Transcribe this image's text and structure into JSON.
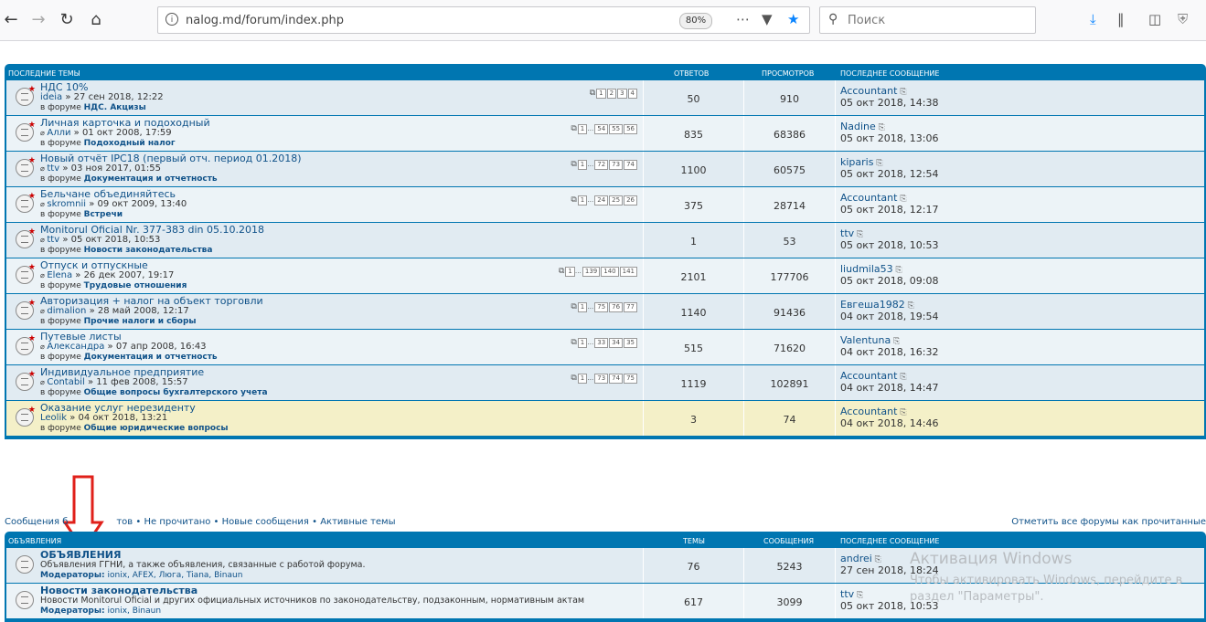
{
  "browser": {
    "url": "nalog.md/forum/index.php",
    "zoom": "80%",
    "search_placeholder": "Поиск"
  },
  "recent": {
    "header": {
      "topics": "ПОСЛЕДНИЕ ТЕМЫ",
      "replies": "ОТВЕТОВ",
      "views": "ПРОСМОТРОВ",
      "last": "ПОСЛЕДНЕЕ СООБЩЕНИЕ"
    },
    "rows": [
      {
        "title": "НДС 10%",
        "author": "ideia",
        "date": "» 27 сен 2018, 12:22",
        "forum_prefix": "в форуме",
        "forum": "НДС. Акцизы",
        "pages": [
          "1",
          "2",
          "3",
          "4"
        ],
        "replies": "50",
        "views": "910",
        "last_user": "Accountant",
        "last_date": "05 окт 2018, 14:38"
      },
      {
        "title": "Личная карточка и подоходный",
        "author": "Алли",
        "date": "» 01 окт 2008, 17:59",
        "forum_prefix": "в форуме",
        "forum": "Подоходный налог",
        "pages": [
          "1",
          "…",
          "54",
          "55",
          "56"
        ],
        "replies": "835",
        "views": "68386",
        "last_user": "Nadine",
        "last_date": "05 окт 2018, 13:06"
      },
      {
        "title": "Новый отчёт IPC18 (первый отч. период 01.2018)",
        "author": "ttv",
        "date": "» 03 ноя 2017, 01:55",
        "forum_prefix": "в форуме",
        "forum": "Документация и отчетность",
        "pages": [
          "1",
          "…",
          "72",
          "73",
          "74"
        ],
        "replies": "1100",
        "views": "60575",
        "last_user": "kiparis",
        "last_date": "05 окт 2018, 12:54"
      },
      {
        "title": "Бельчане объединяйтесь",
        "author": "skromnii",
        "date": "» 09 окт 2009, 13:40",
        "forum_prefix": "в форуме",
        "forum": "Встречи",
        "pages": [
          "1",
          "…",
          "24",
          "25",
          "26"
        ],
        "replies": "375",
        "views": "28714",
        "last_user": "Accountant",
        "last_date": "05 окт 2018, 12:17"
      },
      {
        "title": "Monitorul Oficial Nr. 377-383 din 05.10.2018",
        "author": "ttv",
        "date": "» 05 окт 2018, 10:53",
        "forum_prefix": "в форуме",
        "forum": "Новости законодательства",
        "pages": [],
        "replies": "1",
        "views": "53",
        "last_user": "ttv",
        "last_date": "05 окт 2018, 10:53"
      },
      {
        "title": "Отпуск и отпускные",
        "author": "Elena",
        "date": "» 26 дек 2007, 19:17",
        "forum_prefix": "в форуме",
        "forum": "Трудовые отношения",
        "pages": [
          "1",
          "…",
          "139",
          "140",
          "141"
        ],
        "replies": "2101",
        "views": "177706",
        "last_user": "liudmila53",
        "last_date": "05 окт 2018, 09:08"
      },
      {
        "title": "Авторизация + налог на объект торговли",
        "author": "dimalion",
        "date": "» 28 май 2008, 12:17",
        "forum_prefix": "в форуме",
        "forum": "Прочие налоги и сборы",
        "pages": [
          "1",
          "…",
          "75",
          "76",
          "77"
        ],
        "replies": "1140",
        "views": "91436",
        "last_user": "Евгеша1982",
        "last_date": "04 окт 2018, 19:54"
      },
      {
        "title": "Путевые листы",
        "author": "Александра",
        "date": "» 07 апр 2008, 16:43",
        "forum_prefix": "в форуме",
        "forum": "Документация и отчетность",
        "pages": [
          "1",
          "…",
          "33",
          "34",
          "35"
        ],
        "replies": "515",
        "views": "71620",
        "last_user": "Valentuna",
        "last_date": "04 окт 2018, 16:32"
      },
      {
        "title": "Индивидуальное предприятие",
        "author": "Contabil",
        "date": "» 11 фев 2008, 15:57",
        "forum_prefix": "в форуме",
        "forum": "Общие вопросы бухгалтерского учета",
        "pages": [
          "1",
          "…",
          "73",
          "74",
          "75"
        ],
        "replies": "1119",
        "views": "102891",
        "last_user": "Accountant",
        "last_date": "04 окт 2018, 14:47"
      },
      {
        "title": "Оказание услуг нерезиденту",
        "author": "Leolik",
        "date": "» 04 окт 2018, 13:21",
        "forum_prefix": "в форуме",
        "forum": "Общие юридические вопросы",
        "pages": [],
        "replies": "3",
        "views": "74",
        "last_user": "Accountant",
        "last_date": "04 окт 2018, 14:46"
      }
    ]
  },
  "links": {
    "left_1": "Сообщения б",
    "left_2": "тов",
    "unread": "Не прочитано",
    "new_posts": "Новые сообщения",
    "active": "Активные темы",
    "sep": "•",
    "mark_read": "Отметить все форумы как прочитанные"
  },
  "announce": {
    "header": {
      "forum": "ОБЪЯВЛЕНИЯ",
      "topics": "ТЕМЫ",
      "posts": "СООБЩЕНИЯ",
      "last": "ПОСЛЕДНЕЕ СООБЩЕНИЕ"
    },
    "rows": [
      {
        "title": "ОБЪЯВЛЕНИЯ",
        "desc": "Объявления ГГНИ, а также объявления, связанные с работой форума.",
        "mods_label": "Модераторы:",
        "mods": "ionix, AFEX, Люга, Tiana, Binaun",
        "topics": "76",
        "posts": "5243",
        "last_user": "andrei",
        "last_date": "27 сен 2018, 18:24"
      },
      {
        "title": "Новости законодательства",
        "desc": "Новости Monitorul Oficial и других официальных источников по законодательству, подзаконным, нормативным актам",
        "mods_label": "Модераторы:",
        "mods": "ionix, Binaun",
        "topics": "617",
        "posts": "3099",
        "last_user": "ttv",
        "last_date": "05 окт 2018, 10:53"
      }
    ]
  },
  "windows": {
    "activation_title": "Активация Windows",
    "activation_text": "Чтобы активировать Windows, перейдите в раздел \"Параметры\"."
  },
  "colors": {
    "header_blue": "#0076b1",
    "row_a": "#e1ebf2",
    "row_b": "#ecf3f7",
    "row_sticky": "#f4f0c8",
    "arrow_red": "#e0201a"
  }
}
